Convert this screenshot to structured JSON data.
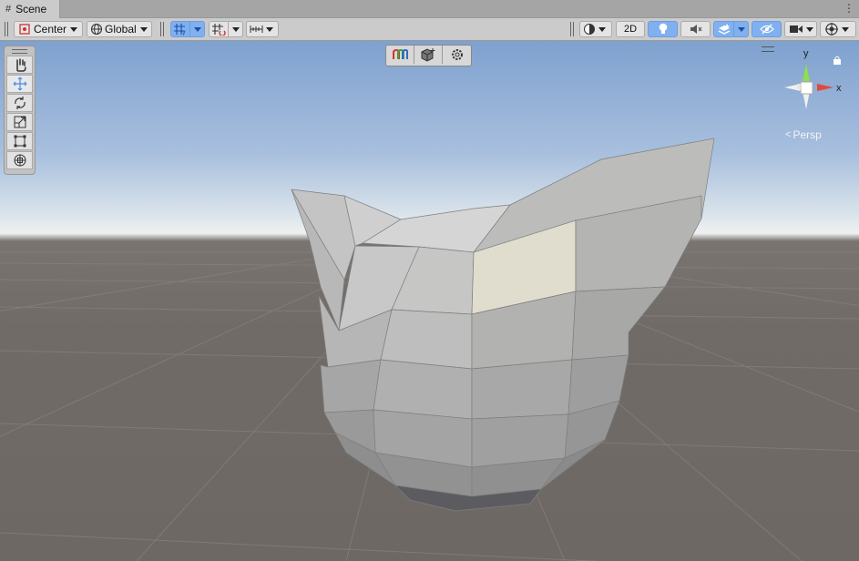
{
  "tab": {
    "title": "Scene",
    "icon": "scene-grid-icon"
  },
  "toolbar": {
    "pivot_mode": "Center",
    "pivot_rotation": "Global",
    "mode_2d": "2D",
    "left_icons": [
      "pivot-center-icon",
      "global-icon",
      "grid-snap-icon",
      "increment-snap-icon",
      "ruler-icon"
    ],
    "right_icons": [
      "shading-mode-icon",
      "lighting-icon",
      "audio-icon",
      "effects-icon",
      "visibility-icon",
      "camera-icon",
      "gizmos-icon"
    ],
    "active": [
      "grid-snap",
      "lighting",
      "effects",
      "visibility"
    ]
  },
  "tools": [
    {
      "name": "hand-tool",
      "icon": "hand-icon",
      "active": false
    },
    {
      "name": "move-tool",
      "icon": "move-icon",
      "active": true
    },
    {
      "name": "rotate-tool",
      "icon": "rotate-icon",
      "active": false
    },
    {
      "name": "scale-tool",
      "icon": "scale-icon",
      "active": false
    },
    {
      "name": "rect-tool",
      "icon": "rect-icon",
      "active": false
    },
    {
      "name": "transform-tool",
      "icon": "transform-icon",
      "active": false
    }
  ],
  "overlay_buttons": [
    "color-channels-icon",
    "mesh-icon",
    "settings-icon"
  ],
  "gizmo": {
    "y_label": "y",
    "x_label": "x",
    "projection": "Persp",
    "lock_icon": "lock-icon"
  },
  "colors": {
    "toolbar_bg": "#cbcbcb",
    "active_blue": "#80b0f0",
    "axis_y": "#8ce04a",
    "axis_x": "#e04a3a",
    "sky": "#8aa8d2",
    "ground": "#726c68"
  }
}
